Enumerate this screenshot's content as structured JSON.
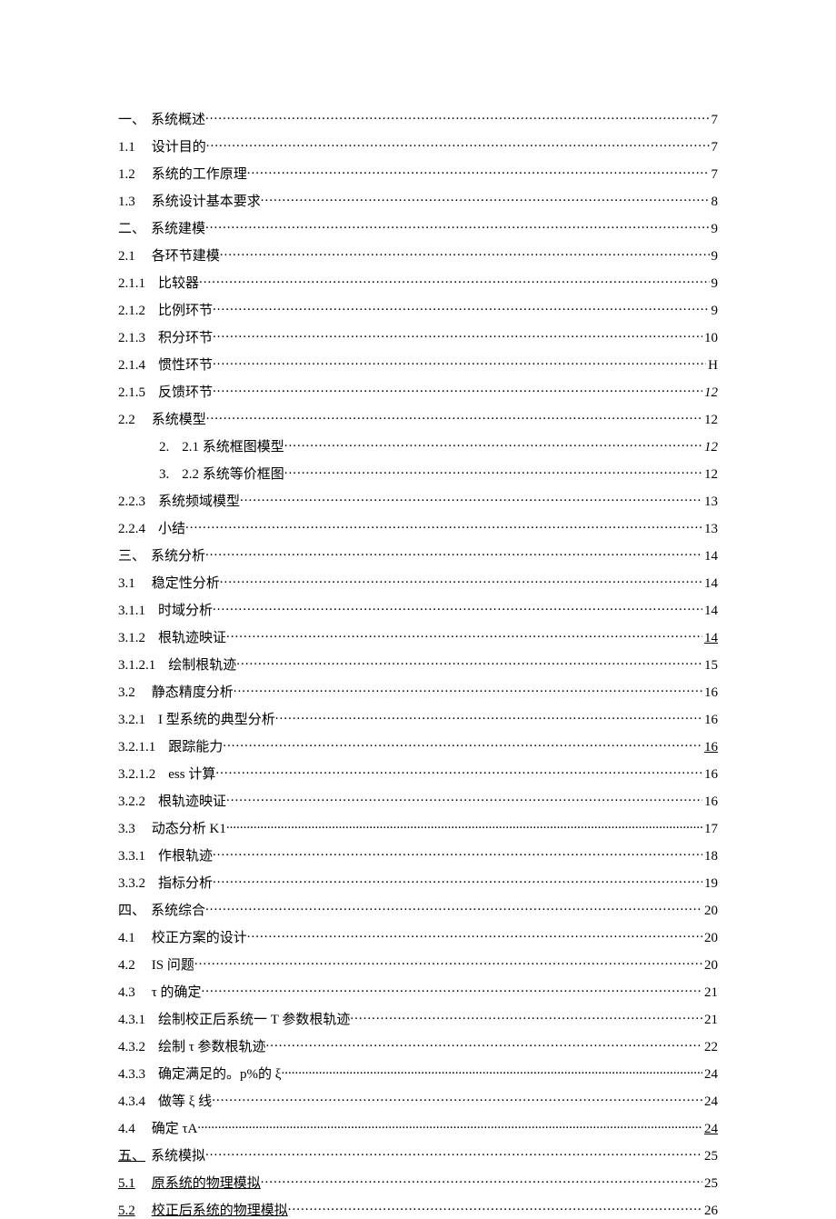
{
  "toc": [
    {
      "num": "一、",
      "title": "系统概述",
      "page": "7",
      "numGap": "gap-s"
    },
    {
      "num": "1.1",
      "title": "设计目的",
      "page": "7",
      "numGap": "gap-l"
    },
    {
      "num": "1.2",
      "title": "系统的工作原理",
      "page": "7",
      "numGap": "gap-l"
    },
    {
      "num": "1.3",
      "title": "系统设计基本要求",
      "page": "8",
      "numGap": "gap-l"
    },
    {
      "num": "二、",
      "title": "系统建模",
      "page": "9",
      "numGap": "gap-s"
    },
    {
      "num": "2.1",
      "title": "各环节建模",
      "page": "9",
      "numGap": "gap-l"
    },
    {
      "num": "2.1.1",
      "title": "比较器",
      "page": "9",
      "numGap": "gap-m"
    },
    {
      "num": "2.1.2",
      "title": "比例环节",
      "page": "9",
      "numGap": "gap-m"
    },
    {
      "num": "2.1.3",
      "title": "积分环节",
      "page": "10",
      "numGap": "gap-m"
    },
    {
      "num": "2.1.4",
      "title": "惯性环节",
      "page": "H",
      "numGap": "gap-m"
    },
    {
      "num": "2.1.5",
      "title": "反馈环节",
      "page": "12",
      "numGap": "gap-m",
      "pageItalic": true
    },
    {
      "num": "2.2",
      "title": "系统模型",
      "page": "12",
      "numGap": "gap-l"
    },
    {
      "num": "2.",
      "title": "2.1 系统框图模型",
      "page": "12",
      "numGap": "gap-m",
      "indent": "indent1",
      "pageItalic": true
    },
    {
      "num": "3.",
      "title": "2.2 系统等价框图",
      "page": "12",
      "numGap": "gap-m",
      "indent": "indent1"
    },
    {
      "num": "2.2.3",
      "title": "系统频域模型",
      "page": "13",
      "numGap": "gap-m"
    },
    {
      "num": "2.2.4",
      "title": "小结",
      "page": "13",
      "numGap": "gap-m"
    },
    {
      "num": "三、",
      "title": "系统分析",
      "page": "14",
      "numGap": "gap-s"
    },
    {
      "num": "3.1",
      "title": "稳定性分析",
      "page": "14",
      "numGap": "gap-l"
    },
    {
      "num": "3.1.1",
      "title": "时域分析",
      "page": "14",
      "numGap": "gap-m"
    },
    {
      "num": "3.1.2",
      "title": "根轨迹映证",
      "page": "14",
      "numGap": "gap-m",
      "pageUnderline": true
    },
    {
      "num": "3.1.2.1",
      "title": "绘制根轨迹",
      "page": "15",
      "numGap": "gap-m"
    },
    {
      "num": "3.2",
      "title": "静态精度分析",
      "page": "16",
      "numGap": "gap-l"
    },
    {
      "num": "3.2.1",
      "title": "I 型系统的典型分析",
      "page": "16",
      "numGap": "gap-m"
    },
    {
      "num": "3.2.1.1",
      "title": "跟踪能力",
      "page": "16",
      "numGap": "gap-m",
      "pageUnderline": true
    },
    {
      "num": "3.2.1.2",
      "title": "ess 计算",
      "page": "16",
      "numGap": "gap-m"
    },
    {
      "num": "3.2.2",
      "title": "根轨迹映证",
      "page": "16",
      "numGap": "gap-m"
    },
    {
      "num": "3.3",
      "title": "动态分析 K1",
      "page": "17",
      "numGap": "gap-l",
      "tight": true
    },
    {
      "num": "3.3.1",
      "title": "作根轨迹",
      "page": "18",
      "numGap": "gap-m"
    },
    {
      "num": "3.3.2",
      "title": "指标分析",
      "page": "19",
      "numGap": "gap-m"
    },
    {
      "num": "四、",
      "title": "系统综合",
      "page": "20",
      "numGap": "gap-s"
    },
    {
      "num": "4.1",
      "title": "校正方案的设计",
      "page": "20",
      "numGap": "gap-l"
    },
    {
      "num": "4.2",
      "title": "IS 问题",
      "page": "20",
      "numGap": "gap-l"
    },
    {
      "num": "4.3",
      "title": "τ 的确定",
      "page": "21",
      "numGap": "gap-l"
    },
    {
      "num": "4.3.1",
      "title": "绘制校正后系统一 T 参数根轨迹",
      "page": "21",
      "numGap": "gap-m"
    },
    {
      "num": "4.3.2",
      "title": "绘制 τ 参数根轨迹",
      "page": "22",
      "numGap": "gap-m"
    },
    {
      "num": "4.3.3",
      "title": "确定满足的。p%的 ξ",
      "page": "24",
      "numGap": "gap-m",
      "tight": true
    },
    {
      "num": "4.3.4",
      "title": "做等 ξ 线",
      "page": "24",
      "numGap": "gap-m"
    },
    {
      "num": "4.4",
      "title": "确定 τA",
      "page": "24",
      "numGap": "gap-l",
      "tight": true,
      "pageUnderline": true
    },
    {
      "num": "五、",
      "title": "系统模拟",
      "page": "25",
      "numGap": "gap-s",
      "numUnderline": true
    },
    {
      "num": "5.1",
      "title": "原系统的物理模拟",
      "page": "25",
      "numGap": "gap-l",
      "numUnderline": true,
      "titleUnderline": true
    },
    {
      "num": "5.2",
      "title": "校正后系统的物理模拟",
      "page": "26",
      "numGap": "gap-l",
      "numUnderline": true,
      "titleUnderline": true
    }
  ]
}
